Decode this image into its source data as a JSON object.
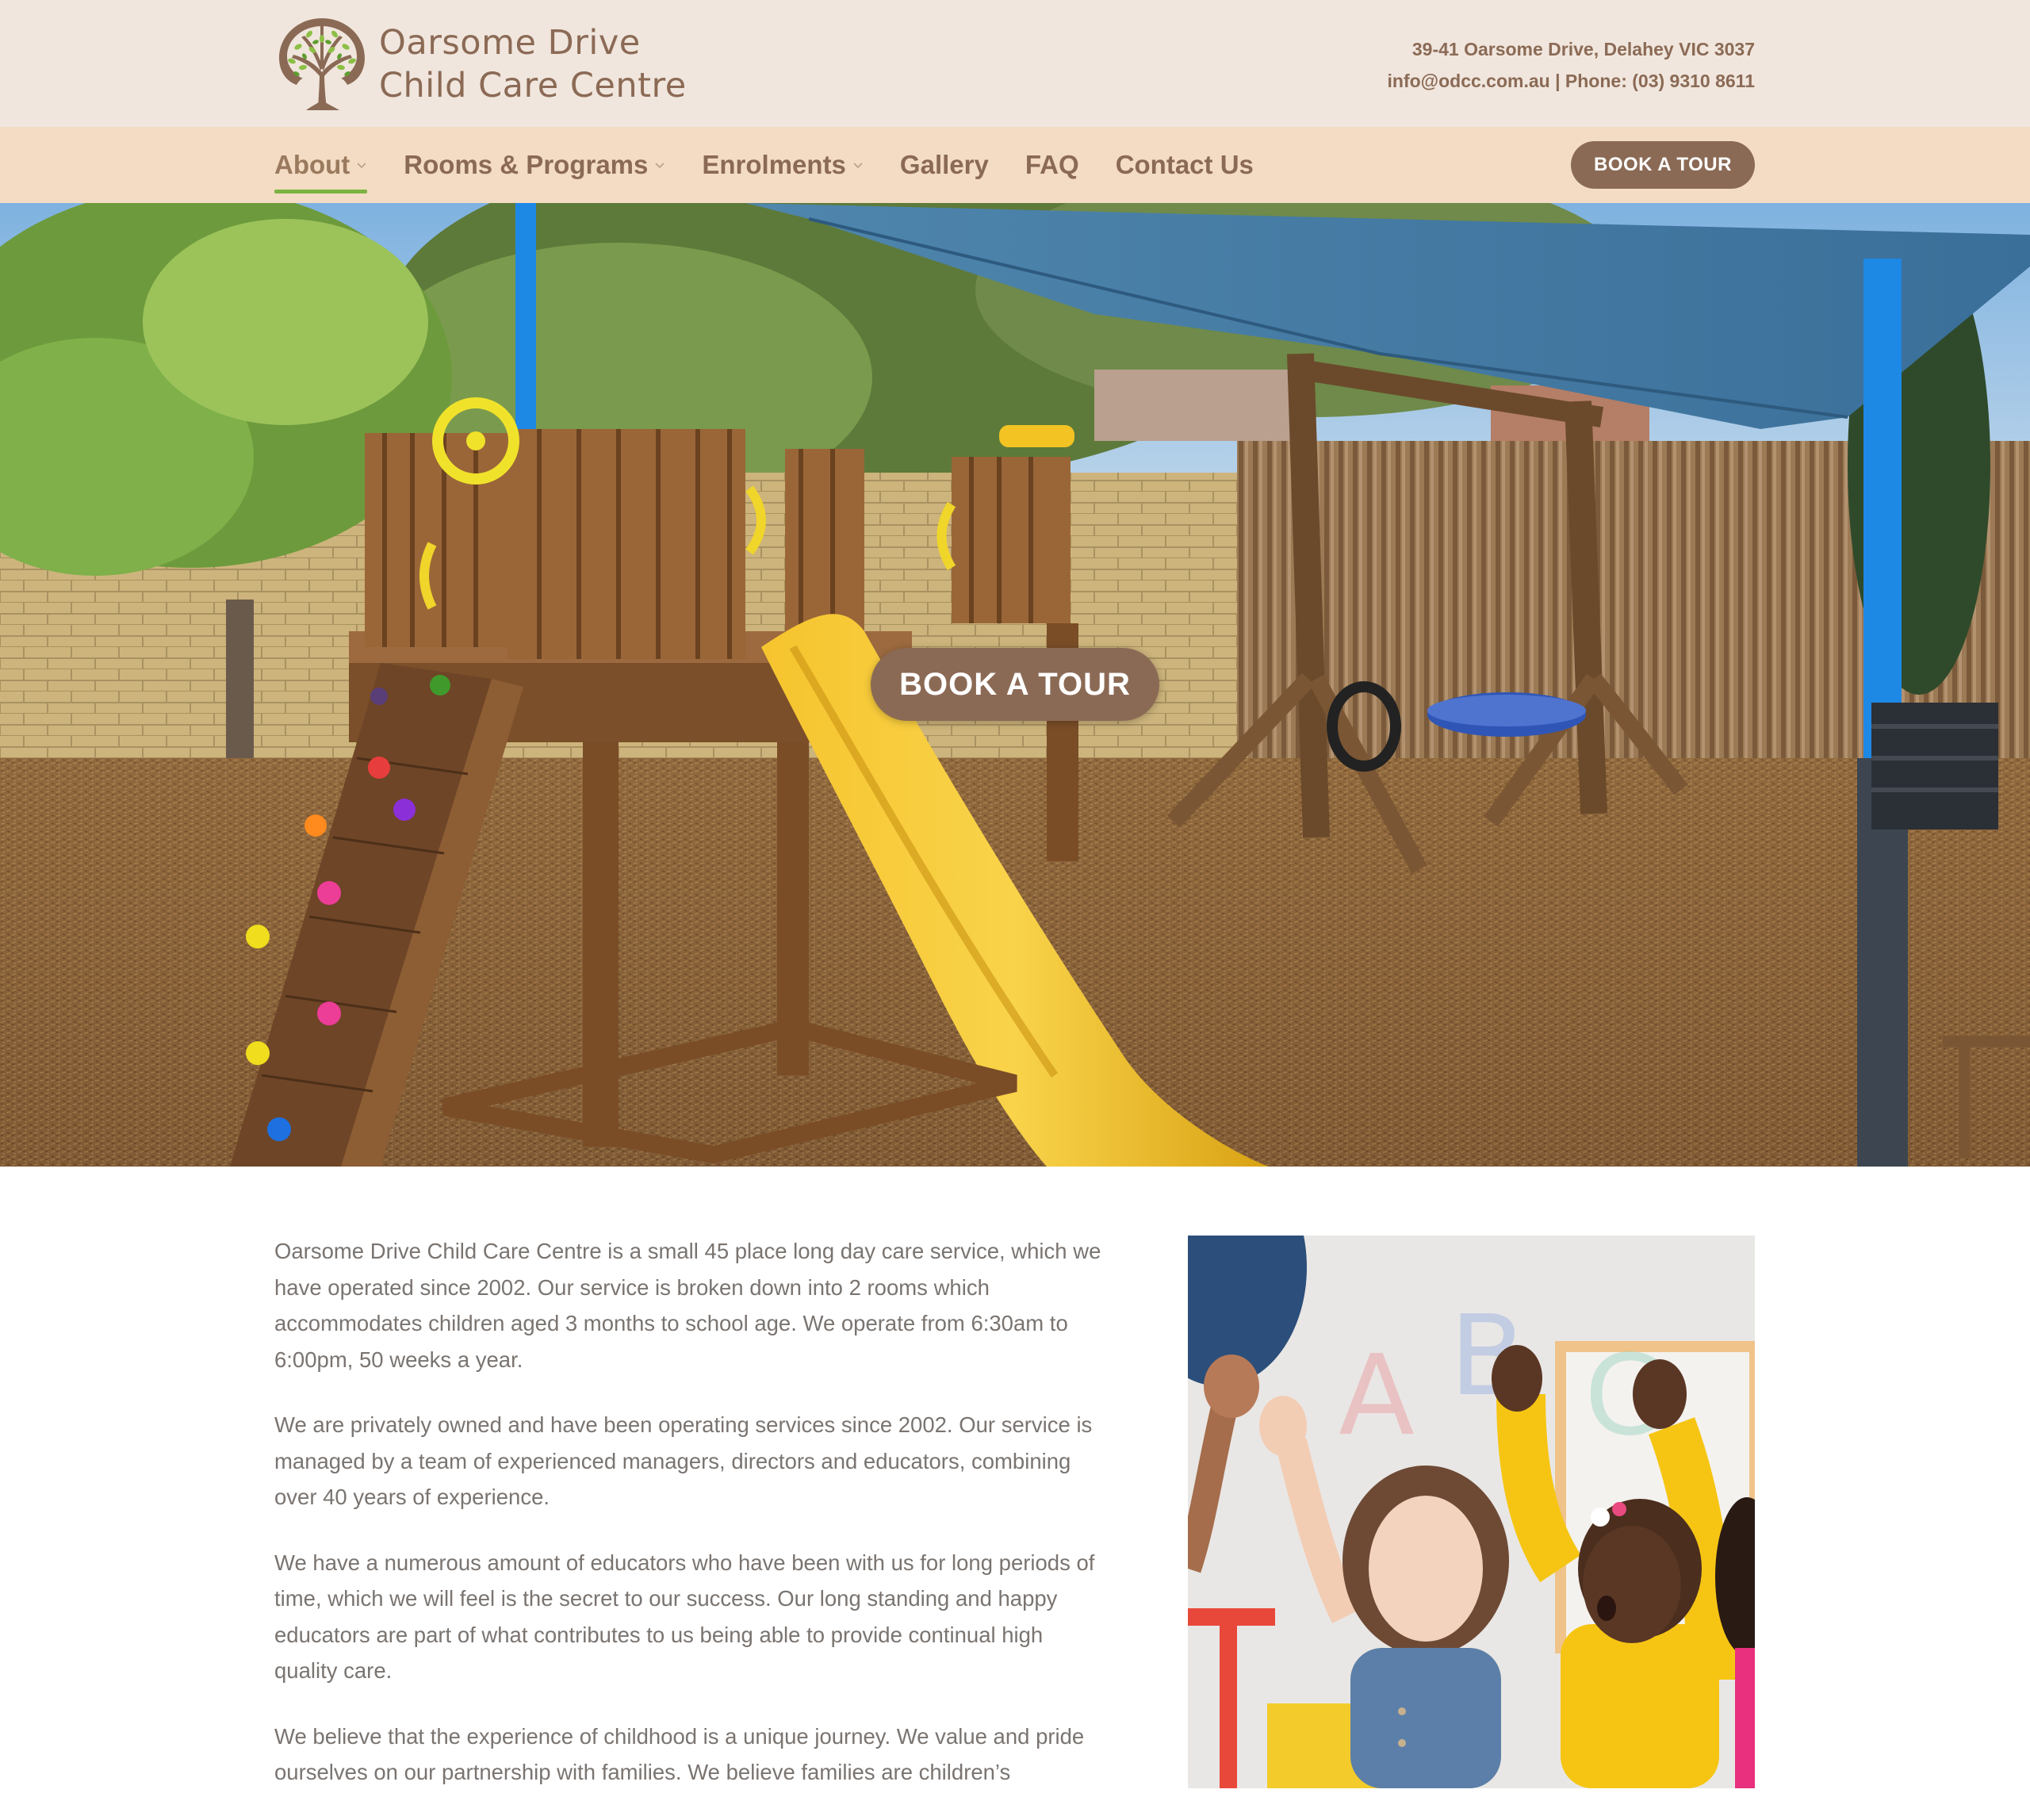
{
  "header": {
    "logo_line1": "Oarsome Drive",
    "logo_line2": "Child Care Centre",
    "address": "39-41 Oarsome Drive, Delahey VIC 3037",
    "email": "info@odcc.com.au",
    "separator": " | ",
    "phone": "Phone: (03) 9310 8611"
  },
  "nav": {
    "items": [
      {
        "label": "About",
        "has_dropdown": true,
        "active": true
      },
      {
        "label": "Rooms & Programs",
        "has_dropdown": true,
        "active": false
      },
      {
        "label": "Enrolments",
        "has_dropdown": true,
        "active": false
      },
      {
        "label": "Gallery",
        "has_dropdown": false,
        "active": false
      },
      {
        "label": "FAQ",
        "has_dropdown": false,
        "active": false
      },
      {
        "label": "Contact Us",
        "has_dropdown": false,
        "active": false
      }
    ],
    "cta_label": "BOOK A TOUR"
  },
  "hero": {
    "cta_label": "BOOK A TOUR",
    "image": "playground with wooden fort, yellow slide, swings and blue shade sail"
  },
  "about": {
    "paragraphs": [
      "Oarsome Drive Child Care Centre is a small 45 place long day care service, which we have operated since 2002. Our service is broken down into 2 rooms which accommodates children aged 3 months to school age. We operate from 6:30am to 6:00pm, 50 weeks a year.",
      "We are privately owned and have been operating services since 2002. Our service is managed by a team of experienced managers, directors and educators, combining over 40 years of experience.",
      "We have a numerous amount of educators who have been with us for long periods of time, which we will feel is the secret to our success. Our long standing and happy educators are part of what contributes to us being able to provide continual high quality care.",
      "We believe that the experience of childhood is a unique journey. We value and pride ourselves on our partnership with families. We believe families are children’s"
    ],
    "photo": "children raising hands in a classroom"
  },
  "colors": {
    "header_bg": "#f0e6dd",
    "nav_bg": "#f3dcc3",
    "brand_brown": "#8b6a55",
    "active_underline": "#7cb342",
    "body_text": "#7a7470"
  }
}
